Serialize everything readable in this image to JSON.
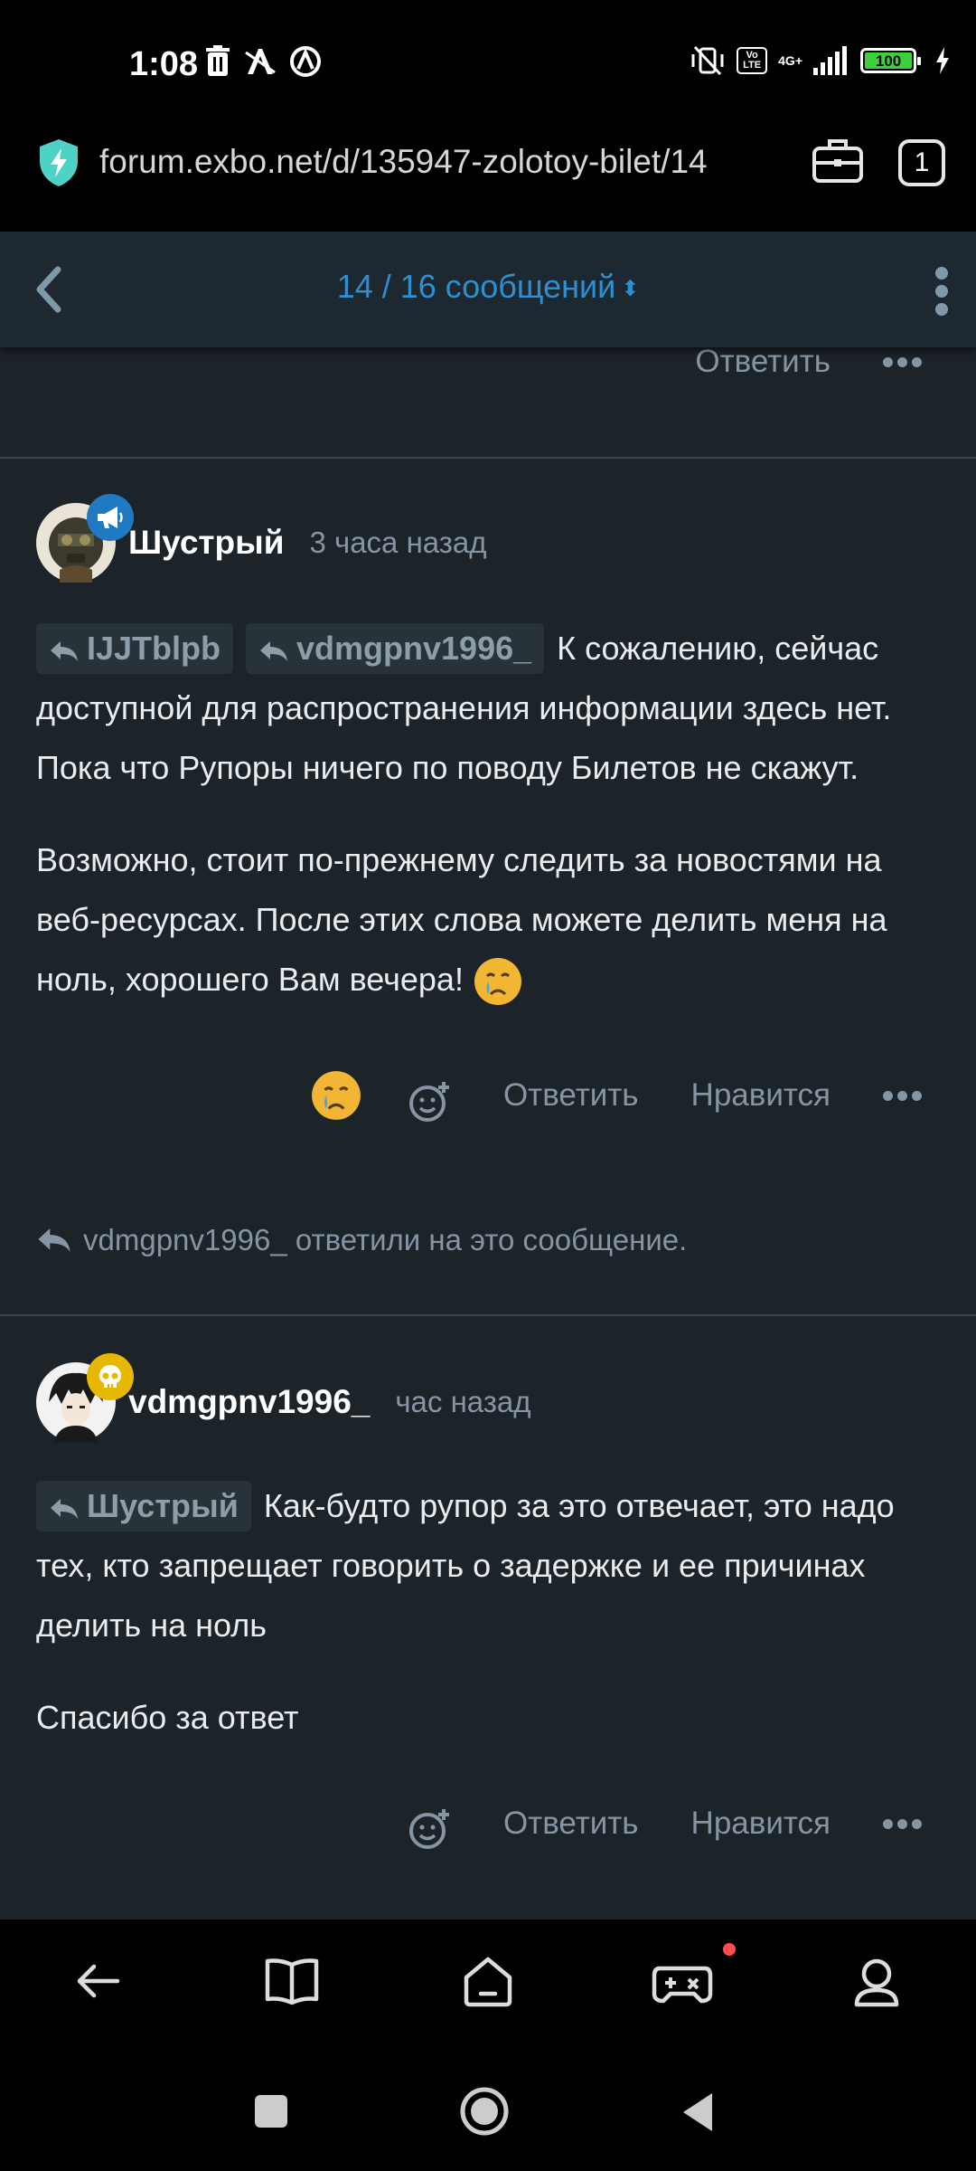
{
  "status_bar": {
    "time": "1:08",
    "network": "4G+",
    "volte": "Vo LTE",
    "battery": "100"
  },
  "url_bar": {
    "url": "forum.exbo.net/d/135947-zolotoy-bilet/14",
    "tab_count": "1"
  },
  "top_nav": {
    "counter": "14 / 16 сообщений"
  },
  "prev_post": {
    "reply_label": "Ответить"
  },
  "posts": [
    {
      "author": "Шустрый",
      "time": "3 часа назад",
      "mentions": [
        "IJJTblpb",
        "vdmgpnv1996_"
      ],
      "paragraphs": [
        "К сожалению, сейчас доступной для распространения информации здесь нет. Пока что Рупоры ничего по поводу Билетов не скажут.",
        "Возможно, стоит по-прежнему следить за новостями на веб-ресурсах. После этих слова можете делить меня на ноль, хорошего Вам вечера!"
      ],
      "reply_label": "Ответить",
      "like_label": "Нравится",
      "replied_note": "vdmgpnv1996_ ответили на это сообщение."
    },
    {
      "author": "vdmgpnv1996_",
      "time": "час назад",
      "mentions": [
        "Шустрый"
      ],
      "paragraphs": [
        "Как-будто рупор за это отвечает, это надо тех, кто запрещает говорить о задержке и ее причинах делить на ноль",
        "Спасибо за ответ"
      ],
      "reply_label": "Ответить",
      "like_label": "Нравится"
    }
  ],
  "colors": {
    "accent": "#2e8fd0",
    "background": "#1c2329",
    "muted": "#8595a3",
    "badge_announce": "#1f7ac2",
    "badge_skull": "#e6b800"
  }
}
